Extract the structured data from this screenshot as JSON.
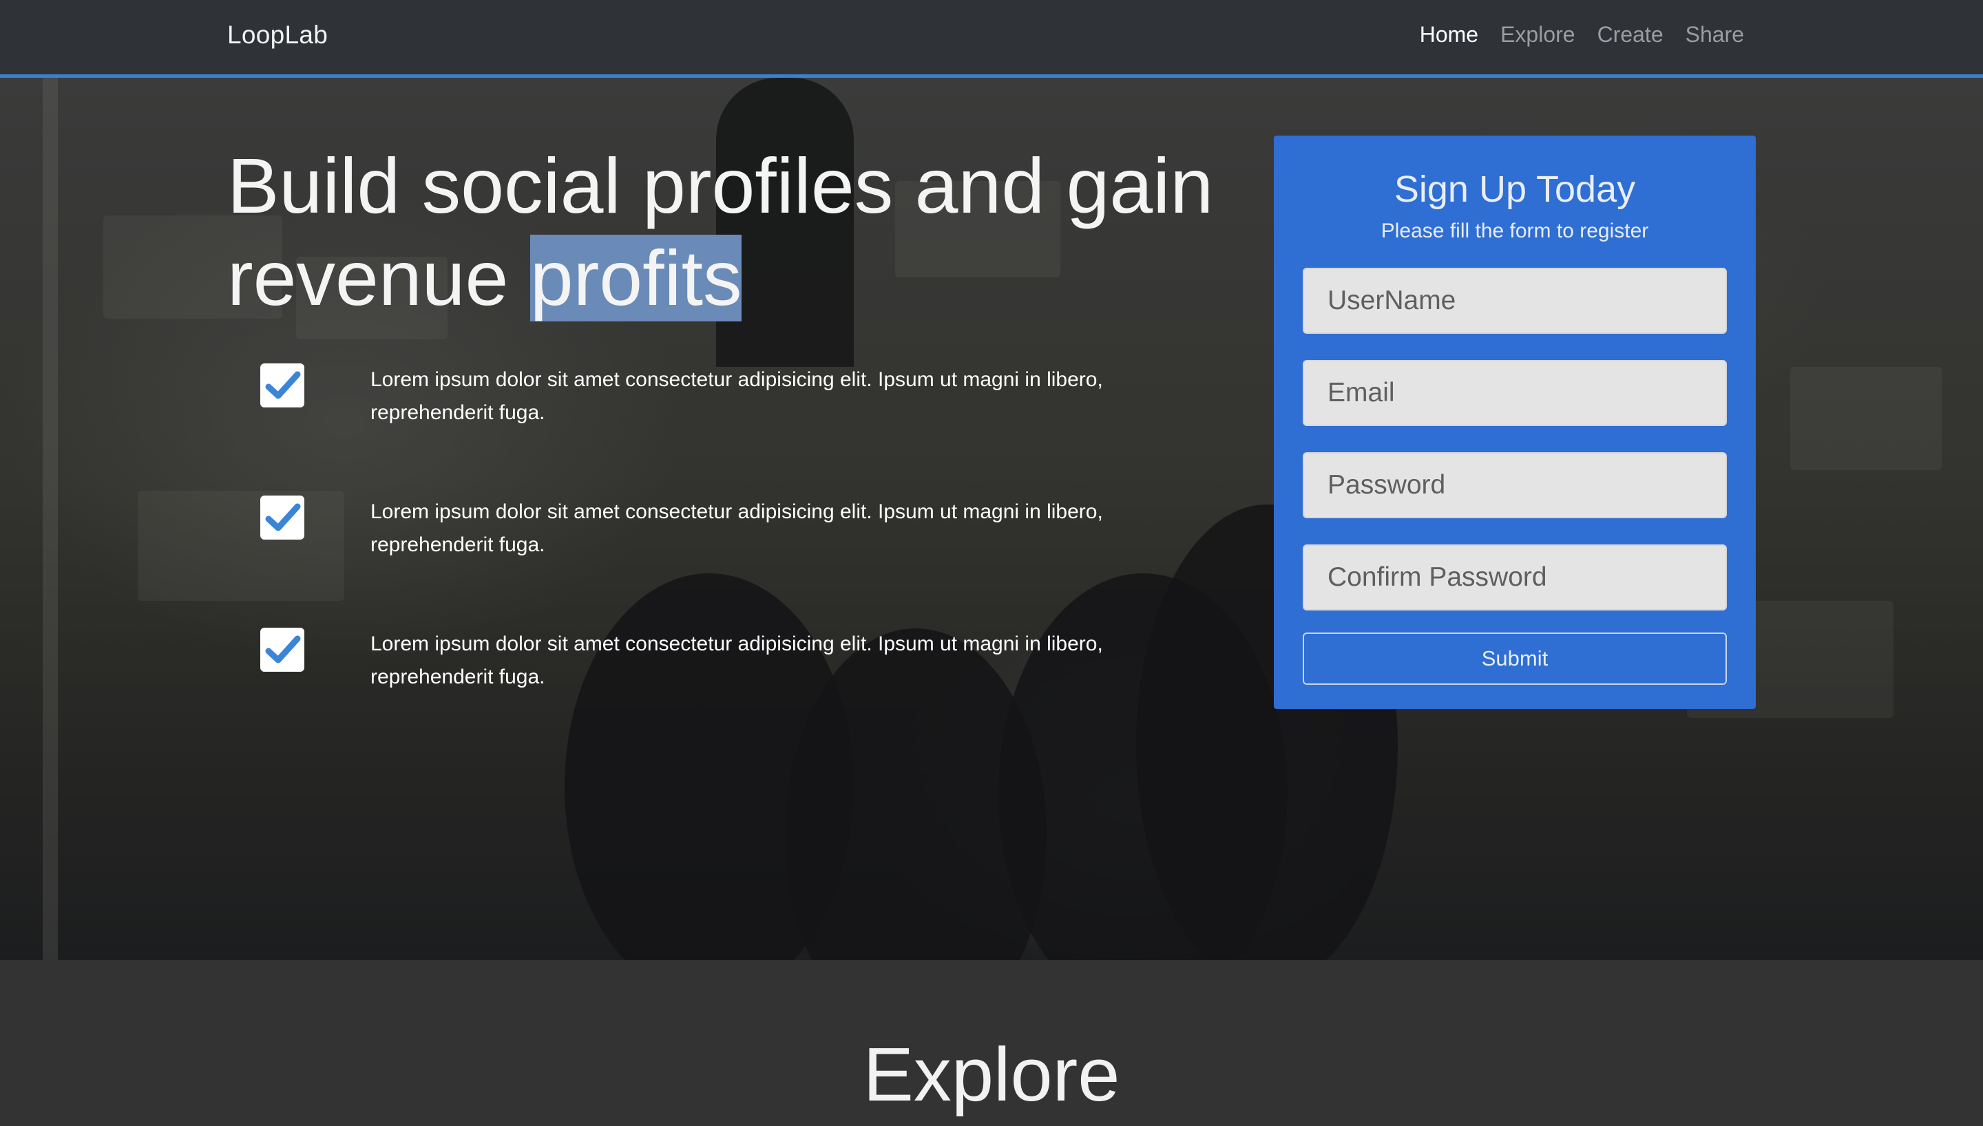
{
  "navbar": {
    "brand": "LoopLab",
    "links": [
      {
        "label": "Home",
        "active": true
      },
      {
        "label": "Explore",
        "active": false
      },
      {
        "label": "Create",
        "active": false
      },
      {
        "label": "Share",
        "active": false
      }
    ]
  },
  "hero": {
    "headline": {
      "part1": "Build ",
      "part2": "social profiles",
      "part3": " and gain revenue ",
      "part4": "profits"
    },
    "features": [
      {
        "text": "Lorem ipsum dolor sit amet consectetur adipisicing elit. Ipsum ut magni in libero, reprehenderit fuga.",
        "icon": "check-square-icon"
      },
      {
        "text": "Lorem ipsum dolor sit amet consectetur adipisicing elit. Ipsum ut magni in libero, reprehenderit fuga.",
        "icon": "check-square-icon"
      },
      {
        "text": "Lorem ipsum dolor sit amet consectetur adipisicing elit. Ipsum ut magni in libero, reprehenderit fuga.",
        "icon": "check-square-icon"
      }
    ]
  },
  "signup": {
    "title": "Sign Up Today",
    "subtitle": "Please fill the form to register",
    "fields": {
      "username": {
        "placeholder": "UserName",
        "value": ""
      },
      "email": {
        "placeholder": "Email",
        "value": ""
      },
      "password": {
        "placeholder": "Password",
        "value": ""
      },
      "confirm": {
        "placeholder": "Confirm Password",
        "value": ""
      }
    },
    "submit_label": "Submit"
  },
  "explore": {
    "title": "Explore"
  },
  "colors": {
    "accent": "#3b7fd2",
    "card": "#2f6ed3",
    "navbar": "#2f3338",
    "section": "#333333"
  }
}
